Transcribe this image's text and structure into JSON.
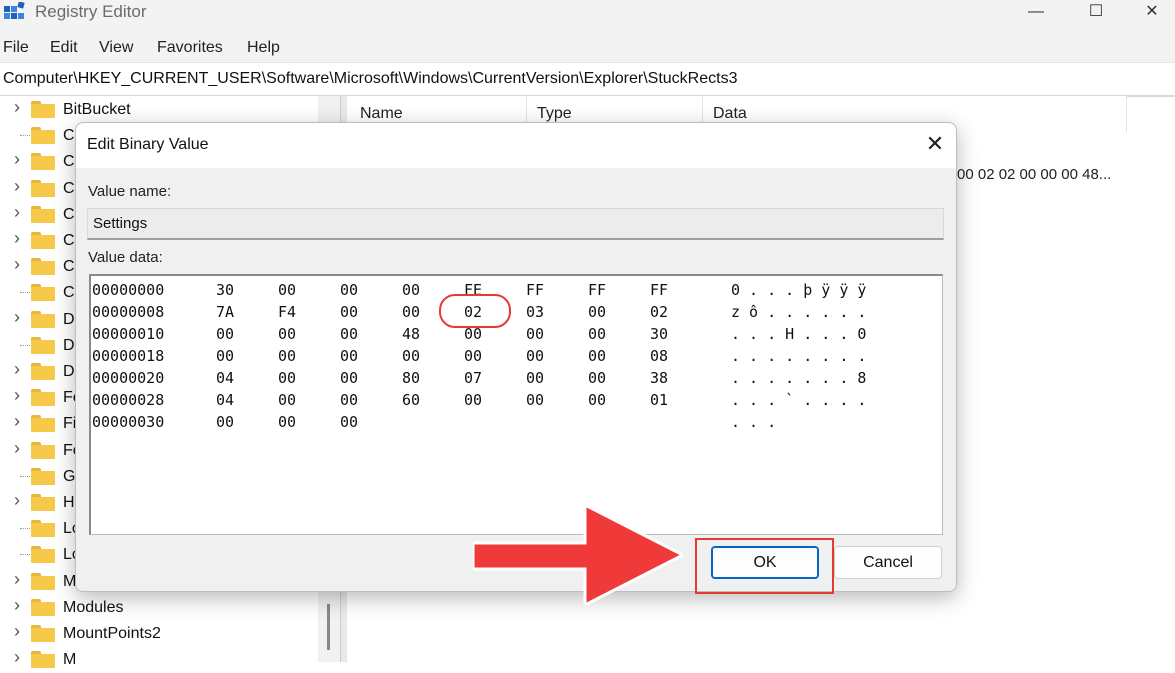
{
  "window": {
    "title": "Registry Editor",
    "minimize_glyph": "—",
    "maximize_glyph": "☐",
    "close_glyph": "✕"
  },
  "menu": [
    "File",
    "Edit",
    "View",
    "Favorites",
    "Help"
  ],
  "address": "Computer\\HKEY_CURRENT_USER\\Software\\Microsoft\\Windows\\CurrentVersion\\Explorer\\StuckRects3",
  "tree": {
    "items": [
      {
        "label": "BitBucket",
        "expandable": true
      },
      {
        "label": "C",
        "expandable": false
      },
      {
        "label": "C",
        "expandable": true
      },
      {
        "label": "C",
        "expandable": true
      },
      {
        "label": "C",
        "expandable": true
      },
      {
        "label": "C",
        "expandable": true
      },
      {
        "label": "C",
        "expandable": true
      },
      {
        "label": "C",
        "expandable": false
      },
      {
        "label": "D",
        "expandable": true
      },
      {
        "label": "D",
        "expandable": false
      },
      {
        "label": "D",
        "expandable": true
      },
      {
        "label": "Fe",
        "expandable": true
      },
      {
        "label": "Fi",
        "expandable": true
      },
      {
        "label": "Fo",
        "expandable": true
      },
      {
        "label": "G",
        "expandable": false
      },
      {
        "label": "H",
        "expandable": true
      },
      {
        "label": "Lo",
        "expandable": false
      },
      {
        "label": "Lo",
        "expandable": false
      },
      {
        "label": "MenuOrder",
        "expandable": true
      },
      {
        "label": "Modules",
        "expandable": true
      },
      {
        "label": "MountPoints2",
        "expandable": true
      },
      {
        "label": "M",
        "expandable": true
      }
    ]
  },
  "list": {
    "columns": [
      "Name",
      "Type",
      "Data"
    ],
    "data_peek": "00 02 02 00 00 00 48..."
  },
  "dialog": {
    "title": "Edit Binary Value",
    "close_glyph": "✕",
    "value_name_label": "Value name:",
    "value_name": "Settings",
    "value_data_label": "Value data:",
    "rows": [
      {
        "offset": "00000000",
        "bytes": [
          "30",
          "00",
          "00",
          "00",
          "FE",
          "FF",
          "FF",
          "FF"
        ],
        "ascii": "0 . . . þ ÿ ÿ ÿ"
      },
      {
        "offset": "00000008",
        "bytes": [
          "7A",
          "F4",
          "00",
          "00",
          "02",
          "03",
          "00",
          "02"
        ],
        "ascii": "z ô . . . . . ."
      },
      {
        "offset": "00000010",
        "bytes": [
          "00",
          "00",
          "00",
          "48",
          "00",
          "00",
          "00",
          "30"
        ],
        "ascii": ". . . H . . . 0"
      },
      {
        "offset": "00000018",
        "bytes": [
          "00",
          "00",
          "00",
          "00",
          "00",
          "00",
          "00",
          "08"
        ],
        "ascii": ". . . . . . . ."
      },
      {
        "offset": "00000020",
        "bytes": [
          "04",
          "00",
          "00",
          "80",
          "07",
          "00",
          "00",
          "38"
        ],
        "ascii": ". . . . . . . 8"
      },
      {
        "offset": "00000028",
        "bytes": [
          "04",
          "00",
          "00",
          "60",
          "00",
          "00",
          "00",
          "01"
        ],
        "ascii": ". . . ` . . . ."
      },
      {
        "offset": "00000030",
        "bytes": [
          "00",
          "00",
          "00"
        ],
        "ascii": ". . ."
      }
    ],
    "ok_label": "OK",
    "cancel_label": "Cancel"
  },
  "colors": {
    "annotation_red": "#e53935",
    "accent_blue": "#0067c0",
    "folder_yellow": "#f6c94a"
  }
}
